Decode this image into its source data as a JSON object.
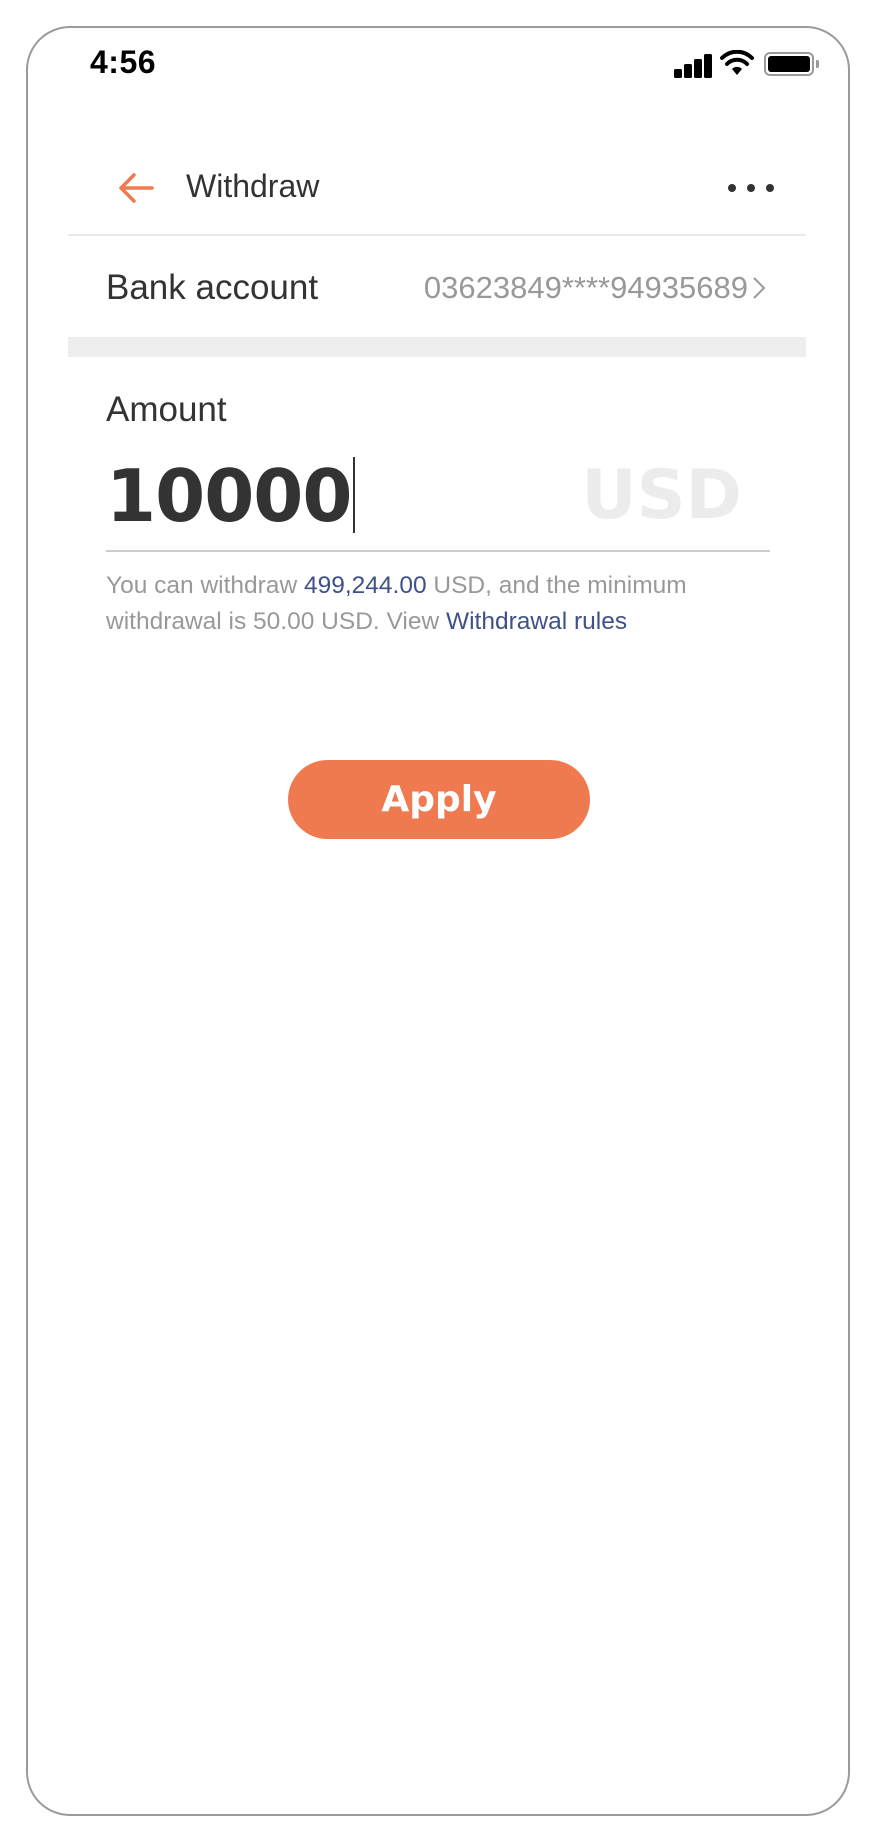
{
  "status_bar": {
    "time": "4:56",
    "icons": [
      "signal-icon",
      "wifi-icon",
      "battery-icon"
    ]
  },
  "header": {
    "back_icon": "arrow-left-icon",
    "title": "Withdraw",
    "more_icon": "more-horizontal-icon"
  },
  "bank_account": {
    "label": "Bank account",
    "value": "03623849****94935689",
    "chevron_icon": "chevron-right-icon"
  },
  "amount": {
    "label": "Amount",
    "value": "10000",
    "currency": "USD"
  },
  "hint": {
    "prefix": "You can withdraw ",
    "available": "499,244.00",
    "middle": " USD, and the minimum withdrawal is 50.00 USD. View ",
    "link": "Withdrawal rules"
  },
  "actions": {
    "apply_label": "Apply"
  },
  "colors": {
    "accent": "#ef7a4f",
    "link": "#3f5188",
    "muted_text": "#999999",
    "primary_text": "#333333"
  }
}
